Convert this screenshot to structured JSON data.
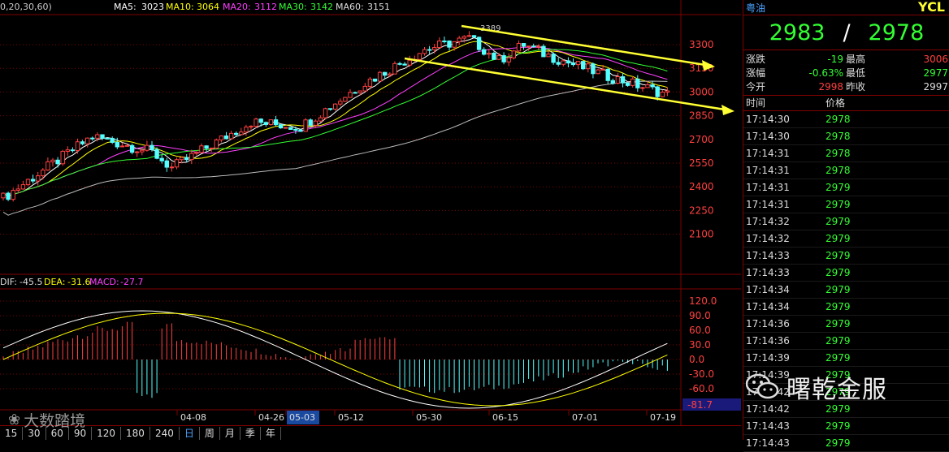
{
  "main_legend": {
    "params": "0,20,30,60)",
    "ma5_label": "MA5:",
    "ma5": "3023",
    "ma10_label": "MA10:",
    "ma10": "3064",
    "ma20_label": "MA20:",
    "ma20": "3112",
    "ma30_label": "MA30:",
    "ma30": "3142",
    "ma60_label": "MA60:",
    "ma60": "3151"
  },
  "price_axis": [
    "3300",
    "3150",
    "3000",
    "2850",
    "2700",
    "2550",
    "2400",
    "2250",
    "2100"
  ],
  "peak_label": "3389",
  "macd_legend": {
    "dif_label": "DIF:",
    "dif": "-45.5",
    "dea_label": "DEA:",
    "dea": "-31.6",
    "macd_label": "MACD:",
    "macd": "-27.7"
  },
  "macd_axis": [
    "120.0",
    "90.0",
    "60.0",
    "30.0",
    "0.0",
    "-30.0",
    "-60.0"
  ],
  "macd_current": "-81.7",
  "date_axis": [
    "04-08",
    "04-26",
    "05-03",
    "05-12",
    "05-30",
    "06-15",
    "07-01",
    "07-19"
  ],
  "toolbar": [
    "15",
    "30",
    "60",
    "90",
    "120",
    "180",
    "240",
    "日",
    "周",
    "月",
    "季",
    "年"
  ],
  "watermark_left": "大数踏境",
  "right_panel": {
    "name": "粤油",
    "code": "YCL",
    "price_a": "2983",
    "separator": "/",
    "price_b": "2978",
    "stats": [
      {
        "l1": "涨跌",
        "v1": "-19",
        "l2": "最高",
        "v2": "3006"
      },
      {
        "l1": "涨幅",
        "v1": "-0.63%",
        "l2": "最低",
        "v2": "2977"
      },
      {
        "l1": "今开",
        "v1": "2998",
        "l2": "昨收",
        "v2": "2997"
      }
    ],
    "tick_headers": {
      "time": "时间",
      "price": "价格"
    },
    "ticks": [
      {
        "time": "17:14:30",
        "price": "2978"
      },
      {
        "time": "17:14:30",
        "price": "2978"
      },
      {
        "time": "17:14:31",
        "price": "2978"
      },
      {
        "time": "17:14:31",
        "price": "2978"
      },
      {
        "time": "17:14:31",
        "price": "2979"
      },
      {
        "time": "17:14:31",
        "price": "2979"
      },
      {
        "time": "17:14:32",
        "price": "2979"
      },
      {
        "time": "17:14:32",
        "price": "2979"
      },
      {
        "time": "17:14:33",
        "price": "2979"
      },
      {
        "time": "17:14:33",
        "price": "2979"
      },
      {
        "time": "17:14:34",
        "price": "2979"
      },
      {
        "time": "17:14:34",
        "price": "2979"
      },
      {
        "time": "17:14:36",
        "price": "2979"
      },
      {
        "time": "17:14:36",
        "price": "2979"
      },
      {
        "time": "17:14:39",
        "price": "2979"
      },
      {
        "time": "17:14:39",
        "price": "2979"
      },
      {
        "time": "17:14:42",
        "price": "2979"
      },
      {
        "time": "17:14:42",
        "price": "2979"
      },
      {
        "time": "17:14:43",
        "price": "2979"
      },
      {
        "time": "17:14:43",
        "price": "2979"
      }
    ],
    "watermark": "曙乾金服"
  },
  "colors": {
    "up": "#ff4040",
    "down": "#54ffff",
    "ma5": "#ffffff",
    "ma10": "#ffff00",
    "ma20": "#ff40ff",
    "ma30": "#33ff33",
    "ma60": "#bbbbbb",
    "grid": "#800000",
    "trend": "#ffff33"
  }
}
